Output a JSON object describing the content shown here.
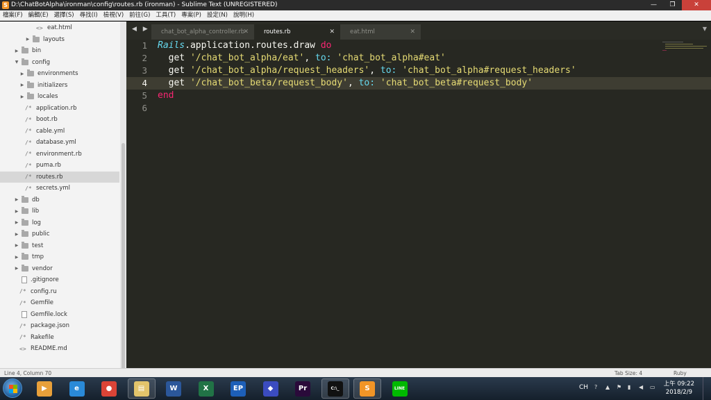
{
  "window": {
    "title": "D:\\ChatBotAlpha\\ironman\\config\\routes.rb (ironman) - Sublime Text (UNREGISTERED)",
    "app_icon": "S",
    "min": "—",
    "max": "❐",
    "close": "✕"
  },
  "menu": [
    "檔案(F)",
    "編輯(E)",
    "選擇(S)",
    "尋找(I)",
    "檢視(V)",
    "前往(G)",
    "工具(T)",
    "專案(P)",
    "設定(N)",
    "說明(H)"
  ],
  "sidebar": {
    "items": [
      {
        "label": "eat.html",
        "kind": "file",
        "glyph": "<>",
        "depth": 4
      },
      {
        "label": "layouts",
        "kind": "folder",
        "depth": 3
      },
      {
        "label": "bin",
        "kind": "folder",
        "depth": 1
      },
      {
        "label": "config",
        "kind": "folder-open",
        "depth": 1
      },
      {
        "label": "environments",
        "kind": "folder",
        "depth": 2
      },
      {
        "label": "initializers",
        "kind": "folder",
        "depth": 2
      },
      {
        "label": "locales",
        "kind": "folder",
        "depth": 2
      },
      {
        "label": "application.rb",
        "kind": "file",
        "glyph": "/*",
        "depth": 2
      },
      {
        "label": "boot.rb",
        "kind": "file",
        "glyph": "/*",
        "depth": 2
      },
      {
        "label": "cable.yml",
        "kind": "file",
        "glyph": "/*",
        "depth": 2
      },
      {
        "label": "database.yml",
        "kind": "file",
        "glyph": "/*",
        "depth": 2
      },
      {
        "label": "environment.rb",
        "kind": "file",
        "glyph": "/*",
        "depth": 2
      },
      {
        "label": "puma.rb",
        "kind": "file",
        "glyph": "/*",
        "depth": 2
      },
      {
        "label": "routes.rb",
        "kind": "file",
        "glyph": "/*",
        "depth": 2,
        "active": true
      },
      {
        "label": "secrets.yml",
        "kind": "file",
        "glyph": "/*",
        "depth": 2
      },
      {
        "label": "db",
        "kind": "folder",
        "depth": 1
      },
      {
        "label": "lib",
        "kind": "folder",
        "depth": 1
      },
      {
        "label": "log",
        "kind": "folder",
        "depth": 1
      },
      {
        "label": "public",
        "kind": "folder",
        "depth": 1
      },
      {
        "label": "test",
        "kind": "folder",
        "depth": 1
      },
      {
        "label": "tmp",
        "kind": "folder",
        "depth": 1
      },
      {
        "label": "vendor",
        "kind": "folder",
        "depth": 1
      },
      {
        "label": ".gitignore",
        "kind": "blank",
        "depth": 1
      },
      {
        "label": "config.ru",
        "kind": "file",
        "glyph": "/*",
        "depth": 1
      },
      {
        "label": "Gemfile",
        "kind": "file",
        "glyph": "/*",
        "depth": 1
      },
      {
        "label": "Gemfile.lock",
        "kind": "blank",
        "depth": 1
      },
      {
        "label": "package.json",
        "kind": "file",
        "glyph": "/*",
        "depth": 1
      },
      {
        "label": "Rakefile",
        "kind": "file",
        "glyph": "/*",
        "depth": 1
      },
      {
        "label": "README.md",
        "kind": "file",
        "glyph": "<>",
        "depth": 1
      }
    ]
  },
  "tabs": [
    {
      "label": "chat_bot_alpha_controller.rb",
      "active": false,
      "close": "✕"
    },
    {
      "label": "routes.rb",
      "active": true,
      "close": "✕"
    },
    {
      "label": "eat.html",
      "active": false,
      "close": "✕"
    }
  ],
  "tab_arrows": "◀ ▶",
  "tab_dropdown": "▼",
  "editor": {
    "current_line": 4,
    "lines": [
      {
        "n": "1",
        "tokens": [
          {
            "t": "Rails",
            "c": "c"
          },
          {
            "t": ".application.routes.draw ",
            "c": ""
          },
          {
            "t": "do",
            "c": "k"
          }
        ]
      },
      {
        "n": "2",
        "tokens": [
          {
            "t": "  get ",
            "c": ""
          },
          {
            "t": "'/chat_bot_alpha/eat'",
            "c": "s"
          },
          {
            "t": ", ",
            "c": ""
          },
          {
            "t": "to:",
            "c": "sym"
          },
          {
            "t": " ",
            "c": ""
          },
          {
            "t": "'chat_bot_alpha#eat'",
            "c": "s"
          }
        ]
      },
      {
        "n": "3",
        "tokens": [
          {
            "t": "  get ",
            "c": ""
          },
          {
            "t": "'/chat_bot_alpha/request_headers'",
            "c": "s"
          },
          {
            "t": ", ",
            "c": ""
          },
          {
            "t": "to:",
            "c": "sym"
          },
          {
            "t": " ",
            "c": ""
          },
          {
            "t": "'chat_bot_alpha#request_headers'",
            "c": "s"
          }
        ]
      },
      {
        "n": "4",
        "tokens": [
          {
            "t": "  get ",
            "c": ""
          },
          {
            "t": "'/chat_bot_beta/request_body'",
            "c": "s"
          },
          {
            "t": ", ",
            "c": ""
          },
          {
            "t": "to:",
            "c": "sym"
          },
          {
            "t": " ",
            "c": ""
          },
          {
            "t": "'chat_bot_beta#request_body'",
            "c": "s"
          }
        ]
      },
      {
        "n": "5",
        "tokens": [
          {
            "t": "end",
            "c": "k"
          }
        ]
      },
      {
        "n": "6",
        "tokens": []
      }
    ]
  },
  "status": {
    "position": "Line 4, Column 70",
    "tab_size": "Tab Size: 4",
    "syntax": "Ruby"
  },
  "taskbar": {
    "apps": [
      {
        "name": "media-player-icon",
        "glyph": "▶",
        "color": "#e8a03a"
      },
      {
        "name": "internet-explorer-icon",
        "glyph": "e",
        "color": "#2a8ad8"
      },
      {
        "name": "chrome-icon",
        "glyph": "●",
        "color": "#db4437"
      },
      {
        "name": "file-explorer-icon",
        "glyph": "▤",
        "color": "#e3c46b"
      },
      {
        "name": "word-icon",
        "glyph": "W",
        "color": "#2b579a"
      },
      {
        "name": "excel-icon",
        "glyph": "X",
        "color": "#217346"
      },
      {
        "name": "ep-icon",
        "glyph": "EP",
        "color": "#1d5fb8"
      },
      {
        "name": "diamond-app-icon",
        "glyph": "◆",
        "color": "#3b4cc0"
      },
      {
        "name": "premiere-icon",
        "glyph": "Pr",
        "color": "#2a0a3a"
      },
      {
        "name": "terminal-icon",
        "glyph": "C:\\_",
        "color": "#111111"
      },
      {
        "name": "sublime-icon",
        "glyph": "S",
        "color": "#f29527"
      },
      {
        "name": "line-icon",
        "glyph": "LINE",
        "color": "#00b900"
      }
    ],
    "ime": "CH",
    "clock_time": "上午 09:22",
    "clock_date": "2018/2/9"
  }
}
